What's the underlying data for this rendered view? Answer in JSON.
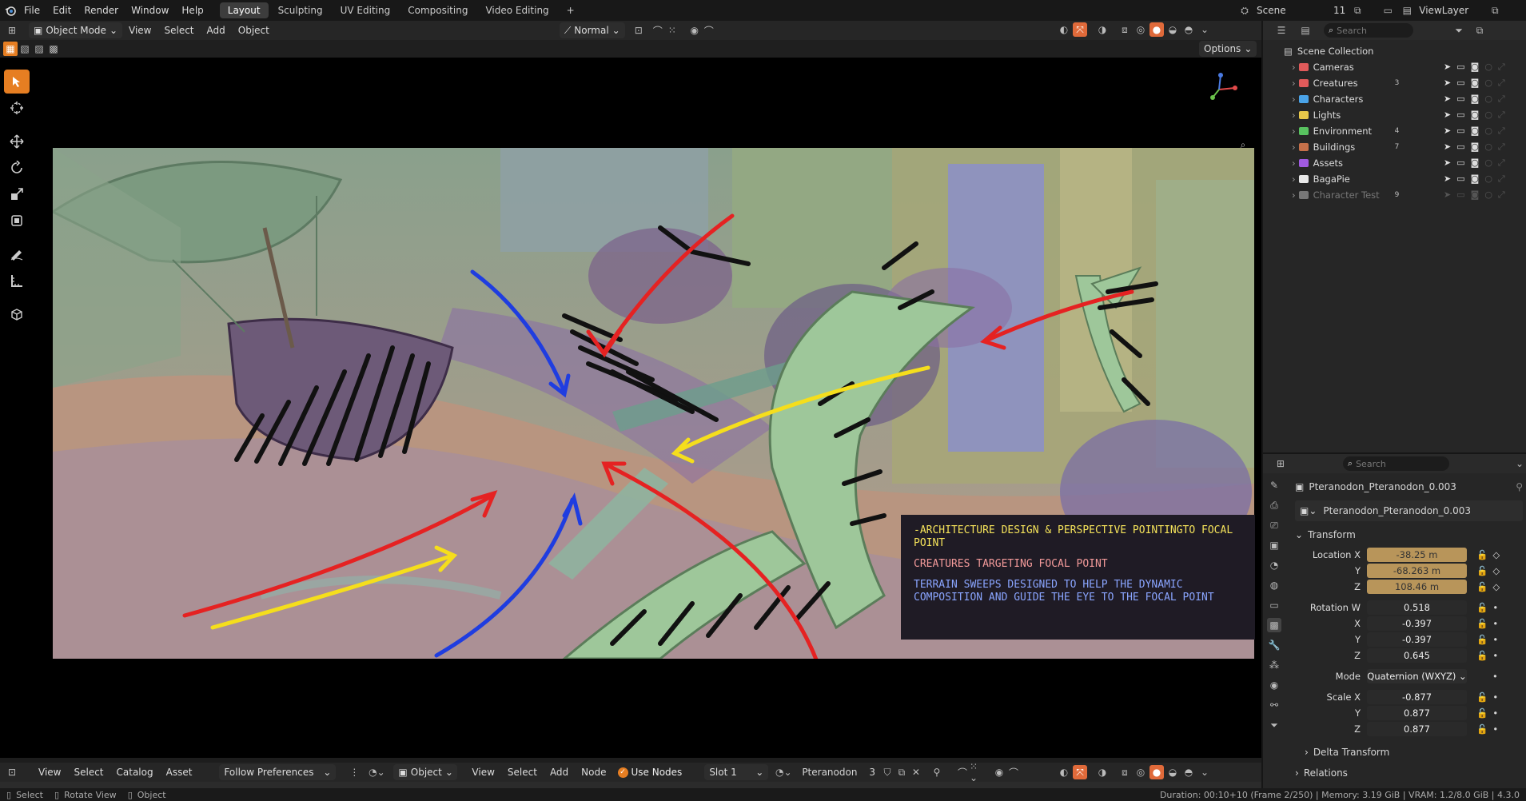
{
  "topbar": {
    "menus": [
      "File",
      "Edit",
      "Render",
      "Window",
      "Help"
    ],
    "workspace_tabs": [
      "Layout",
      "Sculpting",
      "UV Editing",
      "Compositing",
      "Video Editing"
    ],
    "active_tab": "Layout",
    "add_tab": "+",
    "scene_label": "Scene",
    "scene_users": "11",
    "viewlayer_label": "ViewLayer"
  },
  "viewport_header": {
    "mode": "Object Mode",
    "menus": [
      "View",
      "Select",
      "Add",
      "Object"
    ],
    "orientation": "Normal",
    "options_label": "Options"
  },
  "toolbar": {
    "tools": [
      "select-box-tool",
      "cursor-tool",
      "move-tool",
      "rotate-tool",
      "scale-tool",
      "transform-tool",
      "annotate-tool",
      "measure-tool",
      "add-cube-tool"
    ]
  },
  "annotations": {
    "line1": "-Architecture design & perspective pointingto focal point",
    "line2": "Creatures targeting focal point",
    "line3": "Terrain sweeps designed to help the dynamic composition and guide the eye to the focal point",
    "color1": "#f5e35a",
    "color2": "#f39a9a",
    "color3": "#8aa5ff"
  },
  "outliner": {
    "search_placeholder": "Search",
    "root": "Scene Collection",
    "collections": [
      {
        "name": "Cameras",
        "color": "#e05a5a"
      },
      {
        "name": "Creatures",
        "color": "#e05a5a"
      },
      {
        "name": "Characters",
        "color": "#4aa3e8"
      },
      {
        "name": "Lights",
        "color": "#e8c84a"
      },
      {
        "name": "Environment",
        "color": "#58c25f"
      },
      {
        "name": "Buildings",
        "color": "#c5704a"
      },
      {
        "name": "Assets",
        "color": "#a05ae0"
      },
      {
        "name": "BagaPie",
        "color": "#e8e8e8"
      },
      {
        "name": "Character Test",
        "color": "#777777"
      }
    ],
    "badges": {
      "Creatures": "3",
      "Environment": "4",
      "Buildings": "7",
      "Character Test": "9"
    }
  },
  "properties": {
    "search_placeholder": "Search",
    "object_name": "Pteranodon_Pteranodon_0.003",
    "datablock_name": "Pteranodon_Pteranodon_0.003",
    "transform_label": "Transform",
    "location_label": "Location X",
    "location": [
      "-38.25 m",
      "-68.263 m",
      "108.46 m"
    ],
    "rotation_label": "Rotation W",
    "rotation": [
      "0.518",
      "-0.397",
      "-0.397",
      "0.645"
    ],
    "mode_label": "Mode",
    "mode_value": "Quaternion (WXYZ)",
    "scale_label": "Scale X",
    "scale": [
      "-0.877",
      "0.877",
      "0.877"
    ],
    "axis_y": "Y",
    "axis_z": "Z",
    "axis_x": "X",
    "delta_transform": "Delta Transform",
    "relations": "Relations"
  },
  "node_header": {
    "menus": [
      "View",
      "Select",
      "Catalog",
      "Asset"
    ],
    "follow": "Follow Preferences",
    "object_label": "Object",
    "menus2": [
      "View",
      "Select",
      "Add",
      "Node"
    ],
    "use_nodes": "Use Nodes",
    "slot": "Slot 1",
    "material": "Pteranodon",
    "material_users": "3"
  },
  "statusbar": {
    "select": "Select",
    "rotate": "Rotate View",
    "object": "Object",
    "info": "Duration: 00:10+10 (Frame 2/250) | Memory: 3.19 GiB | VRAM: 1.2/8.0 GiB | 4.3.0"
  }
}
